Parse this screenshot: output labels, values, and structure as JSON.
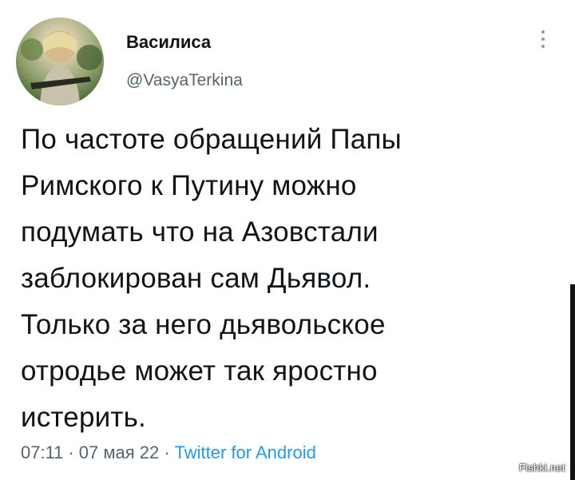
{
  "user": {
    "display_name": "Василиса",
    "handle": "@VasyaTerkina",
    "avatar_icon": "profile-photo"
  },
  "menu": {
    "icon": "vertical-ellipsis-icon"
  },
  "tweet": {
    "text": "По частоте обращений Папы\nРимского к Путину можно\nподумать что на Азовстали\nзаблокирован сам Дьявол.\nТолько за него дьявольское\nотродье может так яростно\nистерить."
  },
  "meta": {
    "time": "07:11",
    "separator": "·",
    "date": "07 мая 22",
    "source": "Twitter for Android"
  },
  "colors": {
    "text": "#0f1419",
    "secondary": "#536471",
    "link": "#1d9bf0"
  },
  "watermark": {
    "text": "Fishki.net"
  }
}
